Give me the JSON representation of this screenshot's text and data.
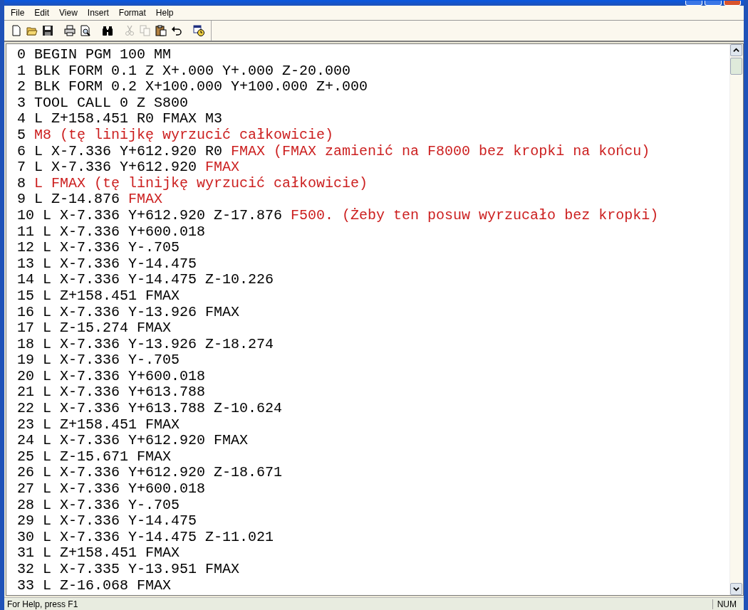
{
  "menu": [
    {
      "label": "File"
    },
    {
      "label": "Edit"
    },
    {
      "label": "View"
    },
    {
      "label": "Insert"
    },
    {
      "label": "Format"
    },
    {
      "label": "Help"
    }
  ],
  "toolbar": [
    {
      "kind": "new",
      "disabled": false
    },
    {
      "kind": "open",
      "disabled": false
    },
    {
      "kind": "save",
      "disabled": false
    },
    {
      "kind": "print",
      "disabled": false
    },
    {
      "kind": "preview",
      "disabled": false
    },
    {
      "kind": "find",
      "disabled": false
    },
    {
      "kind": "cut",
      "disabled": true
    },
    {
      "kind": "copy",
      "disabled": true
    },
    {
      "kind": "paste",
      "disabled": false
    },
    {
      "kind": "undo",
      "disabled": false
    },
    {
      "kind": "datetime",
      "disabled": false
    }
  ],
  "lines": [
    {
      "segments": [
        {
          "text": "0 BEGIN PGM 100 MM",
          "color": "#000000"
        }
      ]
    },
    {
      "segments": [
        {
          "text": "1 BLK FORM 0.1 Z X+.000 Y+.000 Z-20.000",
          "color": "#000000"
        }
      ]
    },
    {
      "segments": [
        {
          "text": "2 BLK FORM 0.2 X+100.000 Y+100.000 Z+.000",
          "color": "#000000"
        }
      ]
    },
    {
      "segments": [
        {
          "text": "3 TOOL CALL 0 Z S800",
          "color": "#000000"
        }
      ]
    },
    {
      "segments": [
        {
          "text": "4 L Z+158.451 R0 FMAX M3",
          "color": "#000000"
        }
      ]
    },
    {
      "segments": [
        {
          "text": "5 ",
          "color": "#000000"
        },
        {
          "text": "M8 (tę linijkę wyrzucić całkowicie)",
          "color": "#cc2020"
        }
      ]
    },
    {
      "segments": [
        {
          "text": "6 L X-7.336 Y+612.920 R0 ",
          "color": "#000000"
        },
        {
          "text": "FMAX (FMAX zamienić na F8000 bez kropki na końcu)",
          "color": "#cc2020"
        }
      ]
    },
    {
      "segments": [
        {
          "text": "7 L X-7.336 Y+612.920 ",
          "color": "#000000"
        },
        {
          "text": "FMAX",
          "color": "#cc2020"
        }
      ]
    },
    {
      "segments": [
        {
          "text": "8 ",
          "color": "#000000"
        },
        {
          "text": "L FMAX (tę linijkę wyrzucić całkowicie)",
          "color": "#cc2020"
        }
      ]
    },
    {
      "segments": [
        {
          "text": "9 L Z-14.876 ",
          "color": "#000000"
        },
        {
          "text": "FMAX",
          "color": "#cc2020"
        }
      ]
    },
    {
      "segments": [
        {
          "text": "10 L X-7.336 Y+612.920 Z-17.876 ",
          "color": "#000000"
        },
        {
          "text": "F500. (Żeby ten posuw wyrzucało bez kropki)",
          "color": "#cc2020"
        }
      ]
    },
    {
      "segments": [
        {
          "text": "11 L X-7.336 Y+600.018",
          "color": "#000000"
        }
      ]
    },
    {
      "segments": [
        {
          "text": "12 L X-7.336 Y-.705",
          "color": "#000000"
        }
      ]
    },
    {
      "segments": [
        {
          "text": "13 L X-7.336 Y-14.475",
          "color": "#000000"
        }
      ]
    },
    {
      "segments": [
        {
          "text": "14 L X-7.336 Y-14.475 Z-10.226",
          "color": "#000000"
        }
      ]
    },
    {
      "segments": [
        {
          "text": "15 L Z+158.451 FMAX",
          "color": "#000000"
        }
      ]
    },
    {
      "segments": [
        {
          "text": "16 L X-7.336 Y-13.926 FMAX",
          "color": "#000000"
        }
      ]
    },
    {
      "segments": [
        {
          "text": "17 L Z-15.274 FMAX",
          "color": "#000000"
        }
      ]
    },
    {
      "segments": [
        {
          "text": "18 L X-7.336 Y-13.926 Z-18.274",
          "color": "#000000"
        }
      ]
    },
    {
      "segments": [
        {
          "text": "19 L X-7.336 Y-.705",
          "color": "#000000"
        }
      ]
    },
    {
      "segments": [
        {
          "text": "20 L X-7.336 Y+600.018",
          "color": "#000000"
        }
      ]
    },
    {
      "segments": [
        {
          "text": "21 L X-7.336 Y+613.788",
          "color": "#000000"
        }
      ]
    },
    {
      "segments": [
        {
          "text": "22 L X-7.336 Y+613.788 Z-10.624",
          "color": "#000000"
        }
      ]
    },
    {
      "segments": [
        {
          "text": "23 L Z+158.451 FMAX",
          "color": "#000000"
        }
      ]
    },
    {
      "segments": [
        {
          "text": "24 L X-7.336 Y+612.920 FMAX",
          "color": "#000000"
        }
      ]
    },
    {
      "segments": [
        {
          "text": "25 L Z-15.671 FMAX",
          "color": "#000000"
        }
      ]
    },
    {
      "segments": [
        {
          "text": "26 L X-7.336 Y+612.920 Z-18.671",
          "color": "#000000"
        }
      ]
    },
    {
      "segments": [
        {
          "text": "27 L X-7.336 Y+600.018",
          "color": "#000000"
        }
      ]
    },
    {
      "segments": [
        {
          "text": "28 L X-7.336 Y-.705",
          "color": "#000000"
        }
      ]
    },
    {
      "segments": [
        {
          "text": "29 L X-7.336 Y-14.475",
          "color": "#000000"
        }
      ]
    },
    {
      "segments": [
        {
          "text": "30 L X-7.336 Y-14.475 Z-11.021",
          "color": "#000000"
        }
      ]
    },
    {
      "segments": [
        {
          "text": "31 L Z+158.451 FMAX",
          "color": "#000000"
        }
      ]
    },
    {
      "segments": [
        {
          "text": "32 L X-7.335 Y-13.951 FMAX",
          "color": "#000000"
        }
      ]
    },
    {
      "segments": [
        {
          "text": "33 L Z-16.068 FMAX",
          "color": "#000000"
        }
      ]
    }
  ],
  "status_bar": {
    "message": "For Help, press F1",
    "indicators": [
      "NUM"
    ]
  }
}
